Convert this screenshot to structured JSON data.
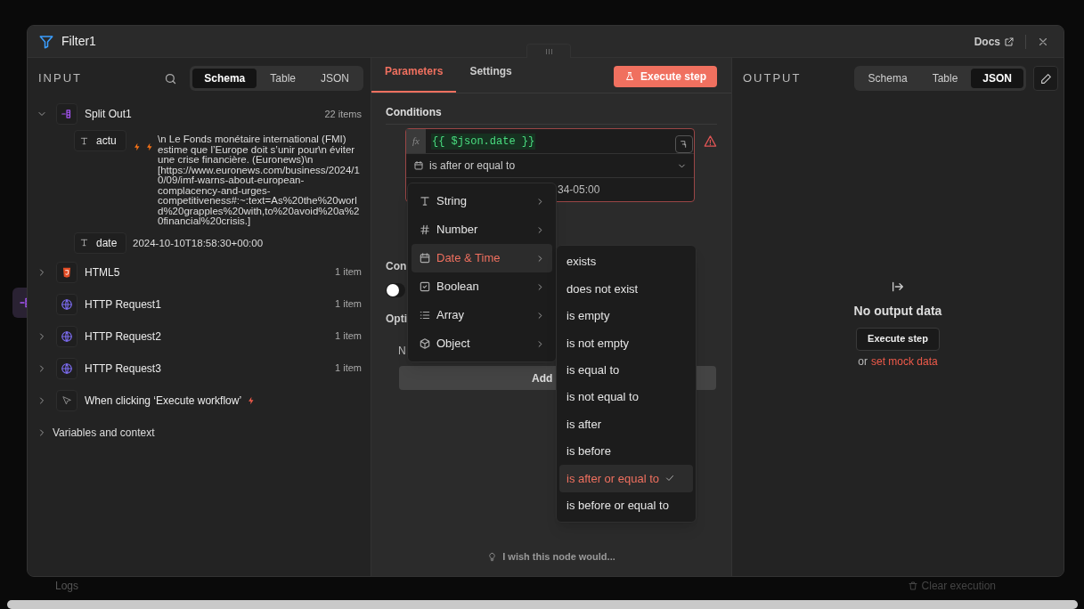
{
  "window": {
    "title": "Filter1",
    "docs_link": "Docs"
  },
  "input": {
    "title": "INPUT",
    "tabs": [
      {
        "label": "Schema",
        "selected": true
      },
      {
        "label": "Table",
        "selected": false
      },
      {
        "label": "JSON",
        "selected": false
      }
    ],
    "nodes": [
      {
        "name": "Split Out1",
        "count": "22 items",
        "kind": "split",
        "expanded": true,
        "chevron": true,
        "fields": [
          {
            "key": "actu",
            "kind": "bolted",
            "value": "\\n Le Fonds monétaire international (FMI) estime que l’Europe doit s’unir pour\\n éviter une crise financière. (Euronews)\\n [https://www.euronews.com/business/2024/10/09/imf-warns-about-european-complacency-and-urges-competitiveness#:~:text=As%20the%20world%20grapples%20with,to%20avoid%20a%20financial%20crisis.]"
          },
          {
            "key": "date",
            "kind": "plain",
            "value": "2024-10-10T18:58:30+00:00"
          }
        ]
      },
      {
        "name": "HTML5",
        "count": "1 item",
        "kind": "html",
        "expanded": false,
        "chevron": true
      },
      {
        "name": "HTTP Request1",
        "count": "1 item",
        "kind": "http",
        "expanded": false,
        "chevron": false
      },
      {
        "name": "HTTP Request2",
        "count": "1 item",
        "kind": "http",
        "expanded": false,
        "chevron": true
      },
      {
        "name": "HTTP Request3",
        "count": "1 item",
        "kind": "http",
        "expanded": false,
        "chevron": true
      },
      {
        "name": "When clicking ‘Execute workflow’",
        "kind": "trigger",
        "expanded": false,
        "chevron": true
      }
    ],
    "variables": "Variables and context"
  },
  "parameters": {
    "tabs": [
      {
        "label": "Parameters",
        "selected": true
      },
      {
        "label": "Settings",
        "selected": false
      }
    ],
    "execute_button": "Execute step",
    "conditions_label": "Conditions",
    "condition": {
      "expression_badge": "fx",
      "expression": "{{ $json.date }}",
      "operator": "is after or equal to",
      "value": "34-05:00",
      "warning": true
    },
    "convert_label": "Con",
    "convert_toggle": {
      "on": false
    },
    "options_label": "Opti",
    "options_empty": "N",
    "add_button": "Add",
    "feedback": "I wish this node would..."
  },
  "type_menu": [
    {
      "label": "String",
      "kind": "string",
      "selected": false
    },
    {
      "label": "Number",
      "kind": "number",
      "selected": false
    },
    {
      "label": "Date & Time",
      "kind": "datetime",
      "selected": true
    },
    {
      "label": "Boolean",
      "kind": "boolean",
      "selected": false
    },
    {
      "label": "Array",
      "kind": "array",
      "selected": false
    },
    {
      "label": "Object",
      "kind": "object",
      "selected": false
    }
  ],
  "operator_menu": [
    {
      "label": "exists",
      "selected": false
    },
    {
      "label": "does not exist",
      "selected": false
    },
    {
      "label": "is empty",
      "selected": false
    },
    {
      "label": "is not empty",
      "selected": false
    },
    {
      "label": "is equal to",
      "selected": false
    },
    {
      "label": "is not equal to",
      "selected": false
    },
    {
      "label": "is after",
      "selected": false
    },
    {
      "label": "is before",
      "selected": false
    },
    {
      "label": "is after or equal to",
      "selected": true
    },
    {
      "label": "is before or equal to",
      "selected": false
    }
  ],
  "output": {
    "title": "OUTPUT",
    "tabs": [
      {
        "label": "Schema",
        "selected": false
      },
      {
        "label": "Table",
        "selected": false
      },
      {
        "label": "JSON",
        "selected": true
      }
    ],
    "empty_title": "No output data",
    "execute_button": "Execute step",
    "or_text": "or",
    "mock_link": "set mock data"
  },
  "logs": {
    "title": "Logs",
    "clear": "Clear execution"
  }
}
